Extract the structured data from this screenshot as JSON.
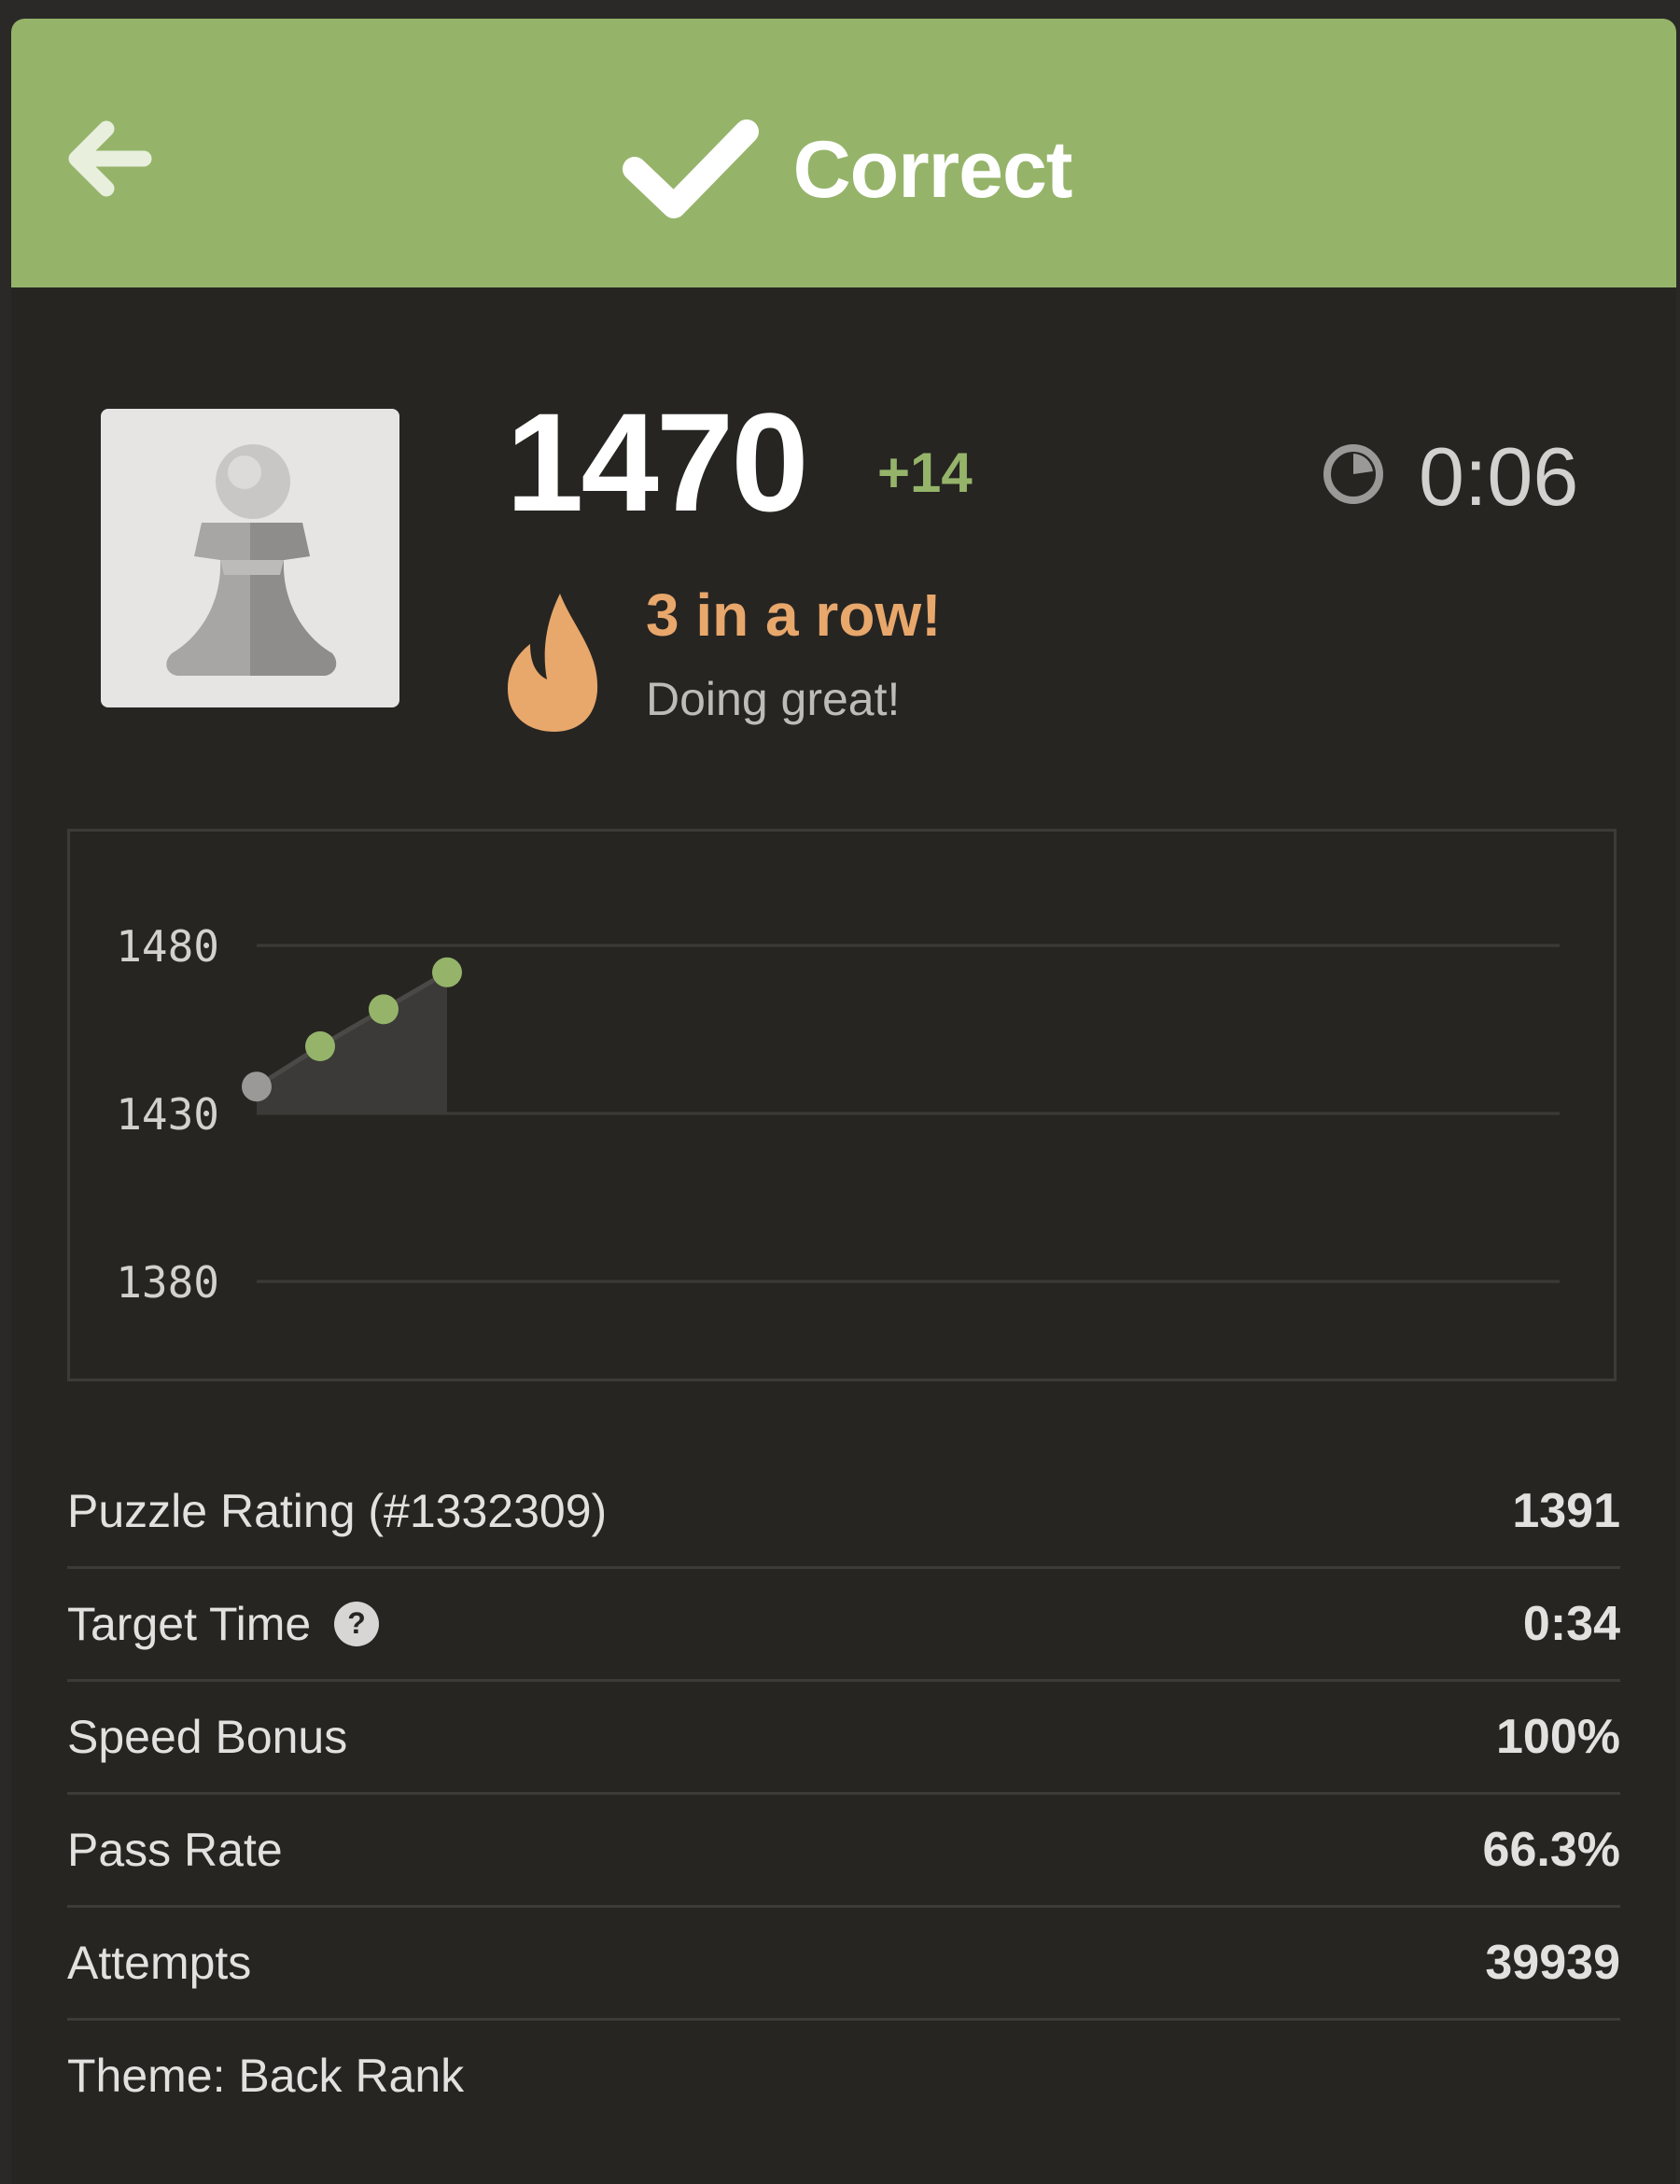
{
  "header": {
    "title": "Correct",
    "background_color": "#95b46a",
    "back_icon": "arrow-left-icon",
    "status_icon": "checkmark-icon"
  },
  "player": {
    "avatar_icon": "pawn-icon",
    "rating": "1470",
    "rating_change": "+14",
    "timer": "0:06",
    "timer_icon": "clock-icon"
  },
  "streak": {
    "icon": "flame-icon",
    "title": "3 in a row!",
    "subtitle": "Doing great!",
    "color": "#e8a76b"
  },
  "chart_data": {
    "type": "area",
    "y_ticks": [
      "1480",
      "1430",
      "1380"
    ],
    "ylim": [
      1380,
      1480
    ],
    "x": [
      1,
      2,
      3,
      4
    ],
    "values": [
      1438,
      1450,
      1461,
      1472
    ],
    "first_point_color": "#9a9997",
    "point_color": "#95b46a",
    "grid": true
  },
  "stats": [
    {
      "label": "Puzzle Rating (#1332309)",
      "value": "1391"
    },
    {
      "label": "Target Time",
      "value": "0:34",
      "help_icon": "question-mark-icon"
    },
    {
      "label": "Speed Bonus",
      "value": "100%"
    },
    {
      "label": "Pass Rate",
      "value": "66.3%"
    },
    {
      "label": "Attempts",
      "value": "39939"
    },
    {
      "label": "Theme: Back Rank",
      "value": ""
    }
  ]
}
